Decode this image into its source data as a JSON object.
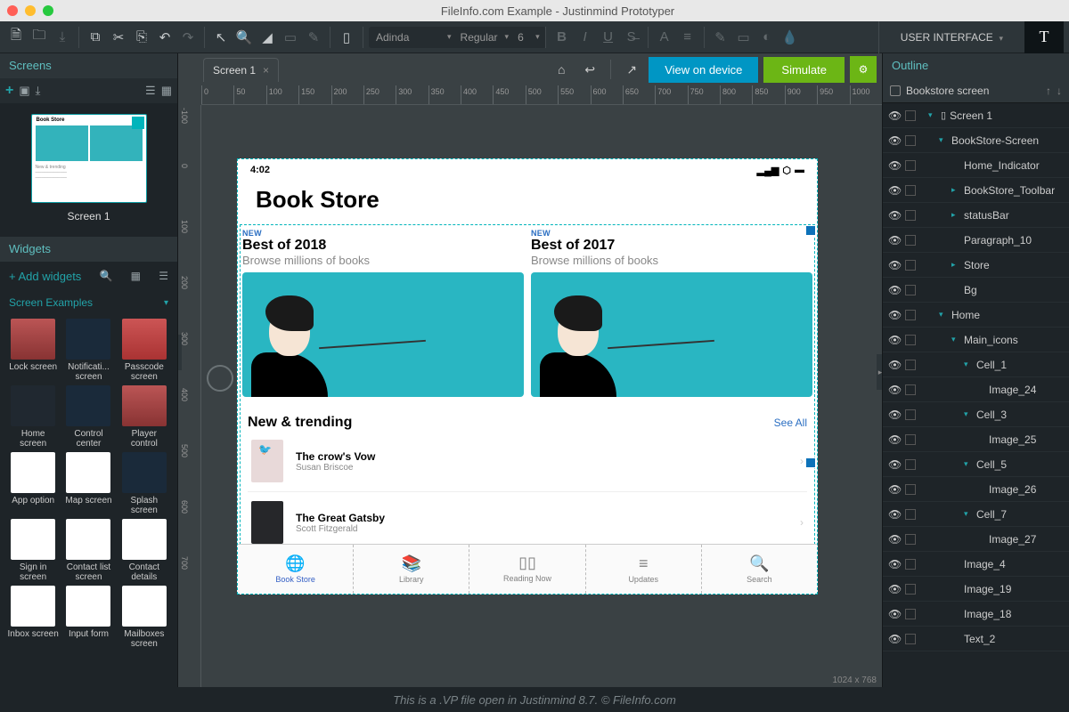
{
  "window": {
    "title": "FileInfo.com Example - Justinmind Prototyper"
  },
  "toolbar": {
    "font_family": "Adinda",
    "font_weight": "Regular",
    "font_size": "6",
    "right_menu": "USER INTERFACE"
  },
  "screens_panel": {
    "title": "Screens",
    "thumb_title": "Book Store",
    "thumb_label": "Screen 1"
  },
  "widgets_panel": {
    "title": "Widgets",
    "add_label": "+ Add widgets",
    "category": "Screen Examples",
    "items": [
      "Lock screen",
      "Notificati... screen",
      "Passcode screen",
      "Home screen",
      "Control center",
      "Player control",
      "App option",
      "Map screen",
      "Splash screen",
      "Sign in screen",
      "Contact list screen",
      "Contact details",
      "Inbox screen",
      "Input form",
      "Mailboxes screen"
    ]
  },
  "center": {
    "tab": "Screen 1",
    "btn_device": "View on device",
    "btn_simulate": "Simulate",
    "ruler_h": [
      "0",
      "50",
      "100",
      "150",
      "200",
      "250",
      "300",
      "350",
      "400",
      "450",
      "500",
      "550",
      "600",
      "650",
      "700",
      "750",
      "800",
      "850",
      "900",
      "950",
      "1000"
    ],
    "ruler_v": [
      "-100",
      "0",
      "100",
      "200",
      "300",
      "400",
      "500",
      "600",
      "700"
    ],
    "canvas_label": "1024 x 768"
  },
  "prototype": {
    "time": "4:02",
    "header": "Book Store",
    "featured": [
      {
        "tag": "NEW",
        "title": "Best of 2018",
        "sub": "Browse millions of books"
      },
      {
        "tag": "NEW",
        "title": "Best of 2017",
        "sub": "Browse millions of books"
      }
    ],
    "trending_title": "New & trending",
    "see_all": "See All",
    "books": [
      {
        "title": "The crow's Vow",
        "author": "Susan Briscoe"
      },
      {
        "title": "The Great Gatsby",
        "author": "Scott Fitzgerald"
      }
    ],
    "tabs": [
      "Book Store",
      "Library",
      "Reading Now",
      "Updates",
      "Search"
    ]
  },
  "outline": {
    "title": "Outline",
    "root": "Bookstore screen",
    "items": [
      {
        "label": "Screen 1",
        "indent": 1,
        "tri": "down",
        "dev": true
      },
      {
        "label": "BookStore-Screen",
        "indent": 2,
        "tri": "down"
      },
      {
        "label": "Home_Indicator",
        "indent": 3,
        "tri": "none"
      },
      {
        "label": "BookStore_Toolbar",
        "indent": 3,
        "tri": "right"
      },
      {
        "label": "statusBar",
        "indent": 3,
        "tri": "right"
      },
      {
        "label": "Paragraph_10",
        "indent": 3,
        "tri": "none"
      },
      {
        "label": "Store",
        "indent": 3,
        "tri": "right"
      },
      {
        "label": "Bg",
        "indent": 3,
        "tri": "none"
      },
      {
        "label": "Home",
        "indent": 2,
        "tri": "down"
      },
      {
        "label": "Main_icons",
        "indent": 3,
        "tri": "down"
      },
      {
        "label": "Cell_1",
        "indent": 4,
        "tri": "down"
      },
      {
        "label": "Image_24",
        "indent": 5,
        "tri": "none"
      },
      {
        "label": "Cell_3",
        "indent": 4,
        "tri": "down"
      },
      {
        "label": "Image_25",
        "indent": 5,
        "tri": "none"
      },
      {
        "label": "Cell_5",
        "indent": 4,
        "tri": "down"
      },
      {
        "label": "Image_26",
        "indent": 5,
        "tri": "none"
      },
      {
        "label": "Cell_7",
        "indent": 4,
        "tri": "down"
      },
      {
        "label": "Image_27",
        "indent": 5,
        "tri": "none"
      },
      {
        "label": "Image_4",
        "indent": 3,
        "tri": "none"
      },
      {
        "label": "Image_19",
        "indent": 3,
        "tri": "none"
      },
      {
        "label": "Image_18",
        "indent": 3,
        "tri": "none"
      },
      {
        "label": "Text_2",
        "indent": 3,
        "tri": "none"
      }
    ]
  },
  "footer": "This is a .VP file open in Justinmind 8.7. © FileInfo.com"
}
